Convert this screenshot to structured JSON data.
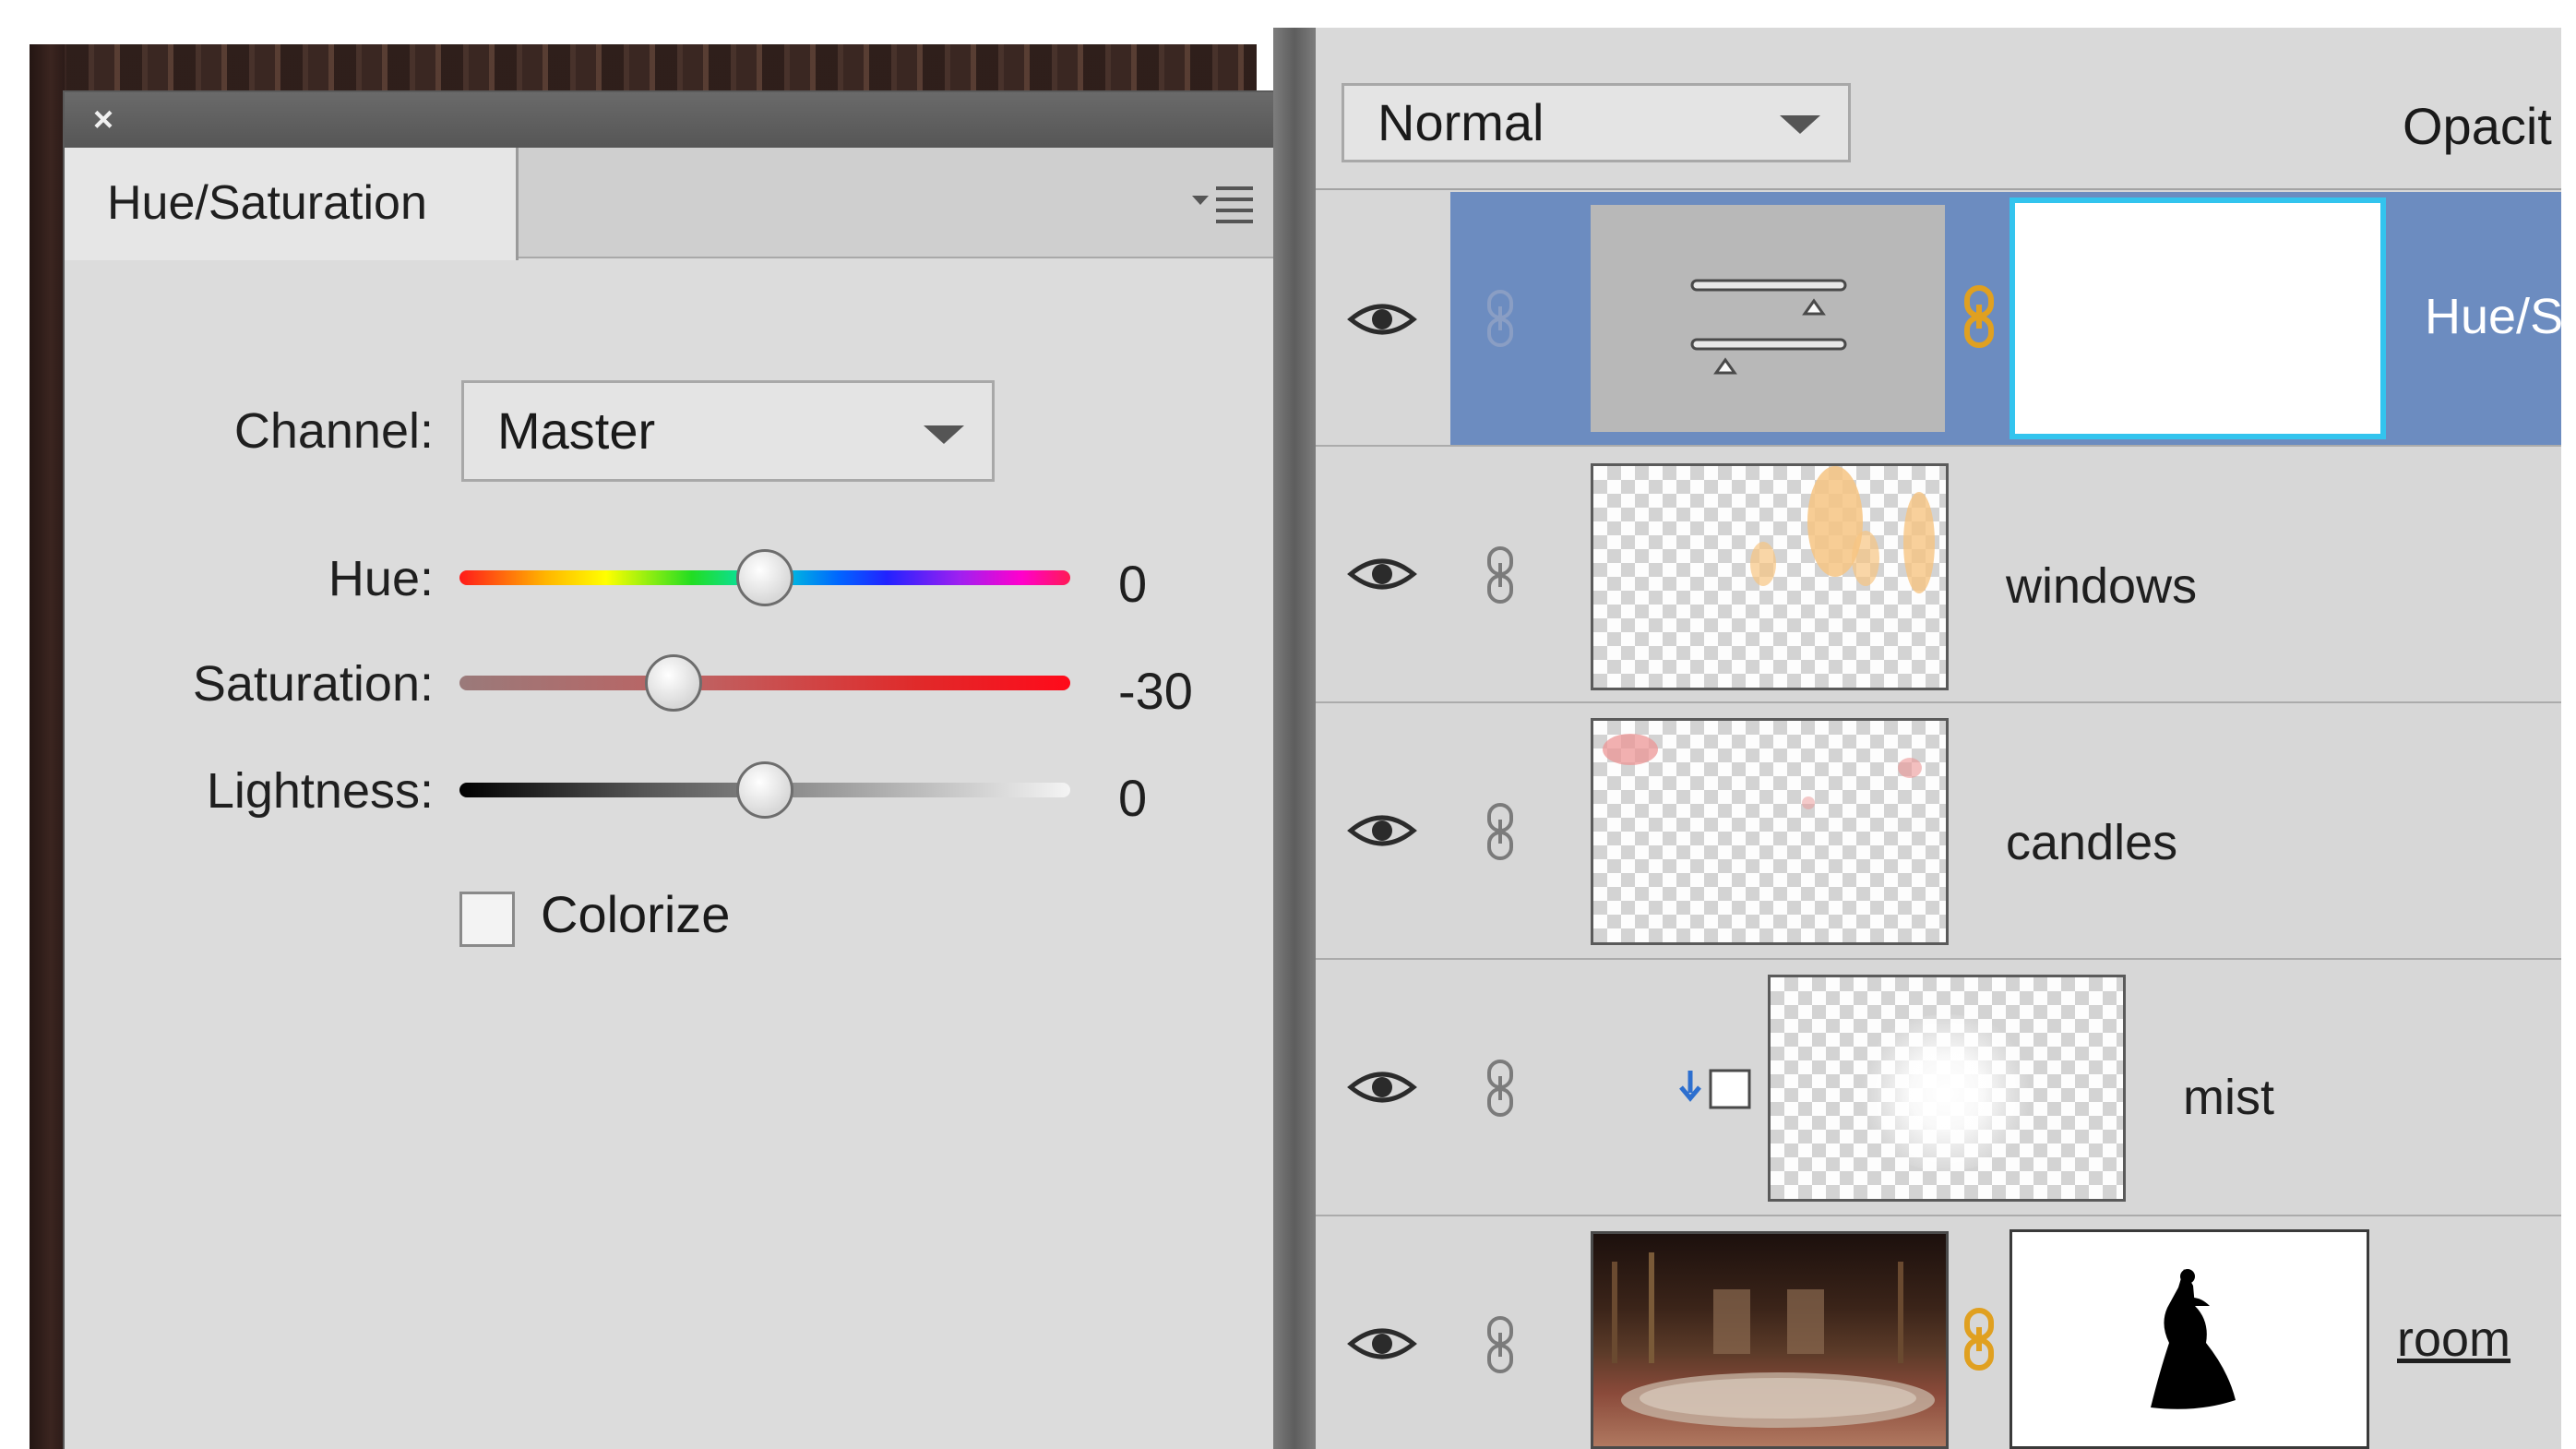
{
  "colors": {
    "selection": "#6c8cc0",
    "panel_bg": "#dcdcdc",
    "titlebar": "#5e5e5e",
    "link_gold": "#e0a020"
  },
  "adjustment_panel": {
    "close_icon": "close-icon",
    "tab_label": "Hue/Saturation",
    "menu_icon": "panel-menu-icon",
    "channel": {
      "label": "Channel:",
      "value": "Master"
    },
    "sliders": [
      {
        "label": "Hue:",
        "value": "0",
        "fraction": 0.5
      },
      {
        "label": "Saturation:",
        "value": "-30",
        "fraction": 0.35
      },
      {
        "label": "Lightness:",
        "value": "0",
        "fraction": 0.5
      }
    ],
    "colorize": {
      "label": "Colorize",
      "checked": false
    }
  },
  "layers_panel": {
    "blend_mode": "Normal",
    "opacity_label": "Opacit",
    "layers": [
      {
        "name": "Hue/S",
        "type": "adjustment",
        "selected": true
      },
      {
        "name": "windows",
        "type": "pixel",
        "selected": false
      },
      {
        "name": "candles",
        "type": "pixel",
        "selected": false
      },
      {
        "name": "mist",
        "type": "pixel-clipped",
        "selected": false
      },
      {
        "name": "room",
        "type": "pixel-masked",
        "selected": false
      }
    ]
  }
}
